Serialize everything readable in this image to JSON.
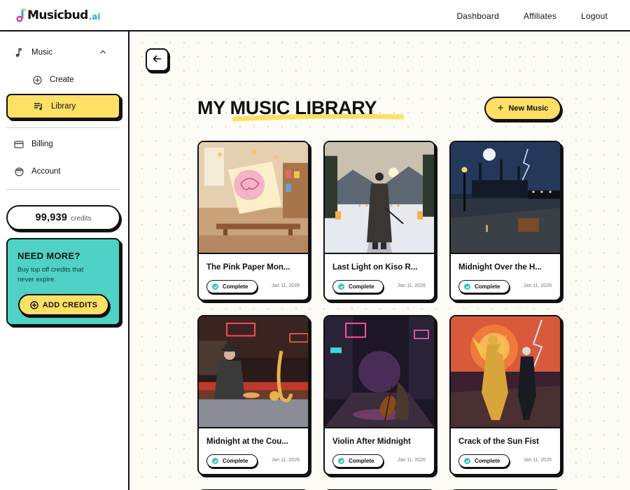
{
  "brand": {
    "name": "Musicbud",
    "suffix": ".ai",
    "accent_teal": "#2aa9c9",
    "accent_yellow": "#ffe066",
    "accent_mint": "#4fd1c5"
  },
  "topnav": {
    "items": [
      "Dashboard",
      "Affiliates",
      "Logout"
    ]
  },
  "sidebar": {
    "music_label": "Music",
    "create_label": "Create",
    "library_label": "Library",
    "billing_label": "Billing",
    "account_label": "Account",
    "credits_value": "99,939",
    "credits_unit": "credits",
    "promo": {
      "title": "NEED MORE?",
      "text": "Buy top off credits that never expire.",
      "button": "ADD CREDITS"
    }
  },
  "main": {
    "title": "MY MUSIC LIBRARY",
    "new_button": "New Music",
    "tracks": [
      {
        "title": "The Pink Paper Mon...",
        "status": "Complete",
        "date": "Jan 11, 2026",
        "art": "playroom"
      },
      {
        "title": "Last Light on Kiso R...",
        "status": "Complete",
        "date": "Jan 11, 2026",
        "art": "samurai"
      },
      {
        "title": "Midnight Over the H...",
        "status": "Complete",
        "date": "Jan 11, 2026",
        "art": "harbor"
      },
      {
        "title": "Midnight at the Cou...",
        "status": "Complete",
        "date": "Jan 11, 2026",
        "art": "diner"
      },
      {
        "title": "Violin After Midnight",
        "status": "Complete",
        "date": "Jan 11, 2026",
        "art": "alley"
      },
      {
        "title": "Crack of the Sun Fist",
        "status": "Complete",
        "date": "Jan 11, 2026",
        "art": "warriors"
      }
    ]
  }
}
